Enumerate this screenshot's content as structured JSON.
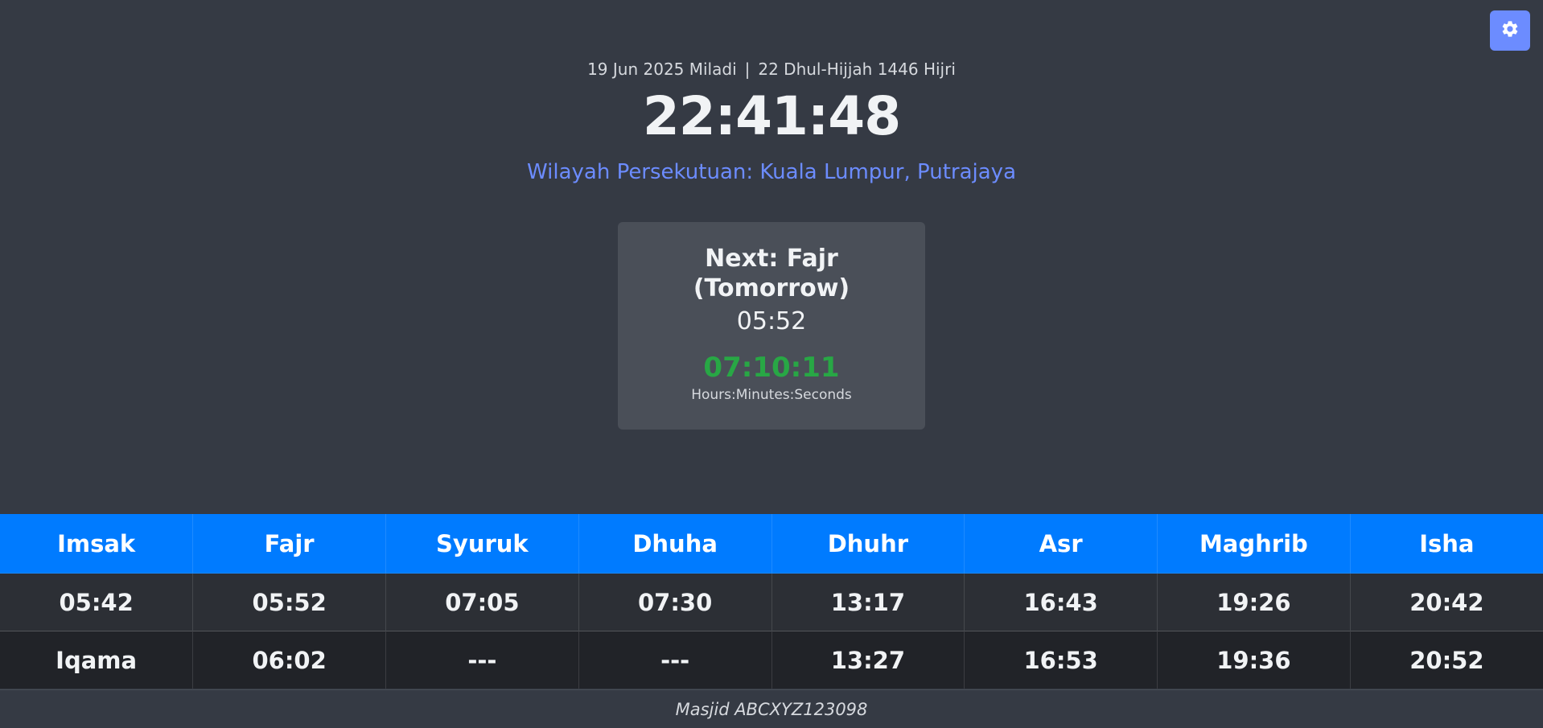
{
  "header": {
    "gregorian_date": "19 Jun 2025 Miladi",
    "separator": "|",
    "hijri_date": "22 Dhul-Hijjah 1446 Hijri",
    "clock": "22:41:48",
    "zone": "Wilayah Persekutuan: Kuala Lumpur, Putrajaya"
  },
  "settings": {
    "icon": "gear-icon"
  },
  "next_prayer": {
    "title": "Next: Fajr (Tomorrow)",
    "time": "05:52",
    "countdown": "07:10:11",
    "countdown_label": "Hours:Minutes:Seconds"
  },
  "prayer_table": {
    "headers": [
      "Imsak",
      "Fajr",
      "Syuruk",
      "Dhuha",
      "Dhuhr",
      "Asr",
      "Maghrib",
      "Isha"
    ],
    "times": [
      "05:42",
      "05:52",
      "07:05",
      "07:30",
      "13:17",
      "16:43",
      "19:26",
      "20:42"
    ],
    "iqama": [
      "Iqama",
      "06:02",
      "---",
      "---",
      "13:27",
      "16:53",
      "19:36",
      "20:52"
    ]
  },
  "footer": {
    "text": "Masjid ABCXYZ123098"
  },
  "colors": {
    "background": "#353a44",
    "accent": "#6c8cff",
    "table_header": "#007bff",
    "countdown": "#28a745"
  }
}
